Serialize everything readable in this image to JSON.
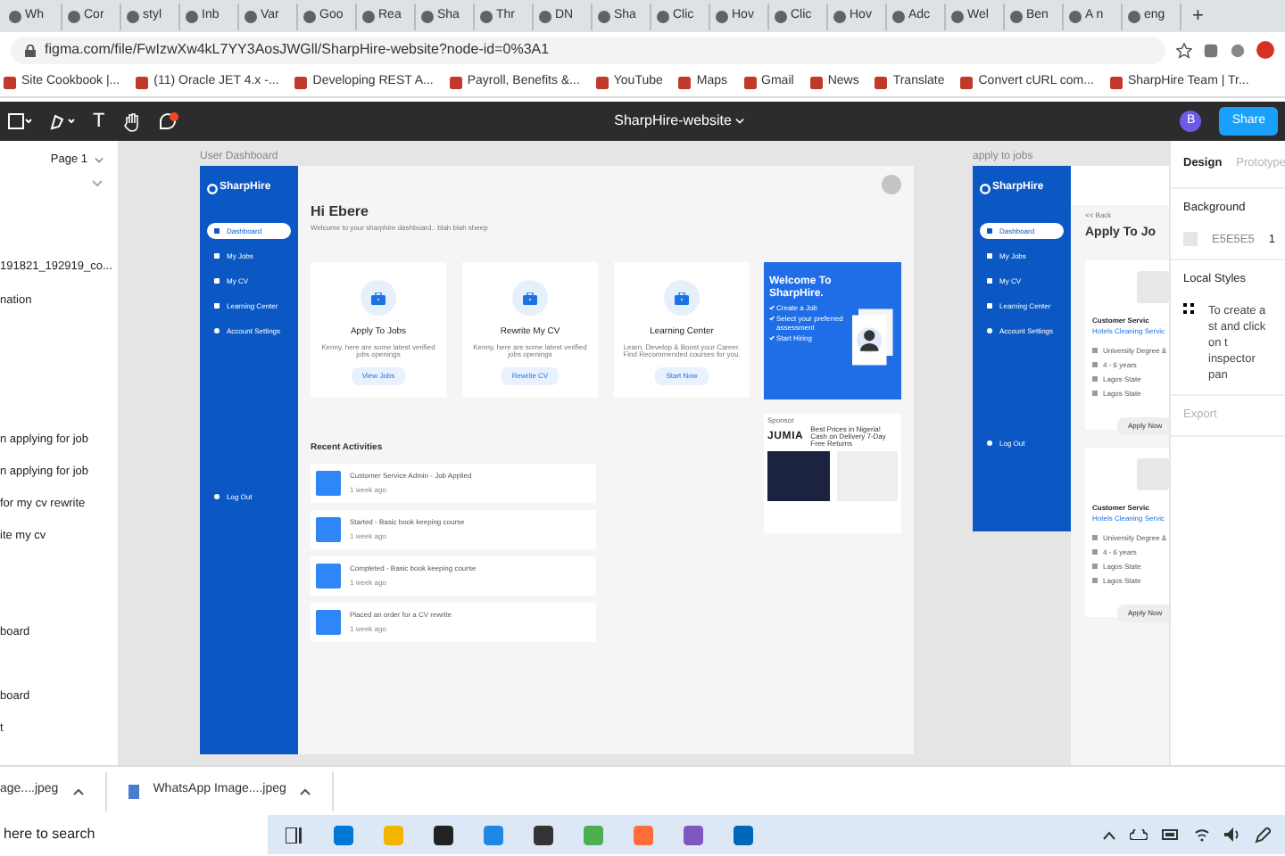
{
  "browser": {
    "tabs": [
      {
        "label": "Wh"
      },
      {
        "label": "Cor"
      },
      {
        "label": "styl"
      },
      {
        "label": "Inb"
      },
      {
        "label": "Var"
      },
      {
        "label": "Goo"
      },
      {
        "label": "Rea"
      },
      {
        "label": "Sha"
      },
      {
        "label": "Thr"
      },
      {
        "label": "DN"
      },
      {
        "label": "Sha"
      },
      {
        "label": "Clic"
      },
      {
        "label": "Hov"
      },
      {
        "label": "Clic"
      },
      {
        "label": "Hov"
      },
      {
        "label": "Adc"
      },
      {
        "label": "Wel"
      },
      {
        "label": "Ben"
      },
      {
        "label": "A n"
      },
      {
        "label": "eng"
      }
    ],
    "new_tab": "+",
    "address": "figma.com/file/FwIzwXw4kL7YY3AosJWGll/SharpHire-website?node-id=0%3A1",
    "bookmarks": [
      "Site Cookbook |...",
      "(11) Oracle JET 4.x -...",
      "Developing REST A...",
      "Payroll, Benefits &...",
      "YouTube",
      "Maps",
      "Gmail",
      "News",
      "Translate",
      "Convert cURL com...",
      "SharpHire Team | Tr..."
    ]
  },
  "figma": {
    "text_tool": "T",
    "title": "SharpHire-website",
    "avatar": "B",
    "share": "Share"
  },
  "layers": {
    "page": "Page 1",
    "items": [
      "191821_192919_co...",
      "nation",
      "n applying for job",
      "n applying for job",
      "for my cv rewrite",
      "ite my cv",
      "board",
      "board",
      "t"
    ]
  },
  "dashboard": {
    "label": "User Dashboard",
    "logo": "SharpHire",
    "nav": [
      {
        "label": "Dashboard",
        "selected": true
      },
      {
        "label": "My Jobs",
        "selected": false
      },
      {
        "label": "My CV",
        "selected": false
      },
      {
        "label": "Learning Center",
        "selected": false
      },
      {
        "label": "Account Settings",
        "selected": false
      }
    ],
    "logout": "Log Out",
    "greeting": "Hi Ebere",
    "welcome": "Welcome to your sharphire dashboard.. blah blah sheep",
    "cards": [
      {
        "title": "Apply To Jobs",
        "text": "Kenny, here are some latest verified jobs openings",
        "button": "View Jobs"
      },
      {
        "title": "Rewrite My CV",
        "text": "Kenny, here are some latest verified jobs openings",
        "button": "Rewrite CV"
      },
      {
        "title": "Learning Center",
        "text": "Learn, Develop & Boost your Career. Find Recommended courses for you.",
        "button": "Start Now"
      }
    ],
    "promo": {
      "title": "Welcome To SharpHire.",
      "bullets": [
        "Create a Job",
        "Select your preferred assessment",
        "Start Hiring"
      ]
    },
    "ad": {
      "label": "Sponsor",
      "brand": "JUMIA",
      "text": "Best Prices in Nigeria! Cash on Delivery 7-Day Free Returns"
    },
    "activities_title": "Recent Activities",
    "activities": [
      {
        "text": "Customer Service Admin - Job Applied",
        "time": "1 week ago"
      },
      {
        "text": "Started - Basic book keeping course",
        "time": "1 week ago"
      },
      {
        "text": "Completed - Basic book keeping course",
        "time": "1 week ago"
      },
      {
        "text": "Placed an order for a CV rewrite",
        "time": "1 week ago"
      }
    ]
  },
  "apply_frame": {
    "label": "apply to jobs",
    "logo": "SharpHire",
    "nav": [
      {
        "label": "Dashboard",
        "selected": true
      },
      {
        "label": "My Jobs",
        "selected": false
      },
      {
        "label": "My CV",
        "selected": false
      },
      {
        "label": "Learning Center",
        "selected": false
      },
      {
        "label": "Account Settings",
        "selected": false
      }
    ],
    "logout": "Log Out",
    "back": "<< Back",
    "heading": "Apply To Jo",
    "jobs": [
      {
        "title": "Customer Servic",
        "company": "Hotels Cleaning Servic",
        "details": [
          "University Degree &",
          "4 - 6 years",
          "Lagos State",
          "Lagos State"
        ],
        "button": "Apply Now"
      },
      {
        "title": "Customer Servic",
        "company": "Hotels Cleaning Servic",
        "details": [
          "University Degree &",
          "4 - 6 years",
          "Lagos State",
          "Lagos State"
        ],
        "button": "Apply Now"
      }
    ]
  },
  "inspector": {
    "tabs": [
      {
        "label": "Design",
        "selected": true
      },
      {
        "label": "Prototype",
        "selected": false
      }
    ],
    "background_title": "Background",
    "background_hex": "E5E5E5",
    "background_opacity": "1",
    "styles_title": "Local Styles",
    "styles_text": "To create a st and click on t inspector pan",
    "export": "Export"
  },
  "downloads": [
    "age....jpeg",
    "WhatsApp Image....jpeg"
  ],
  "taskbar": {
    "search": "here to search"
  }
}
